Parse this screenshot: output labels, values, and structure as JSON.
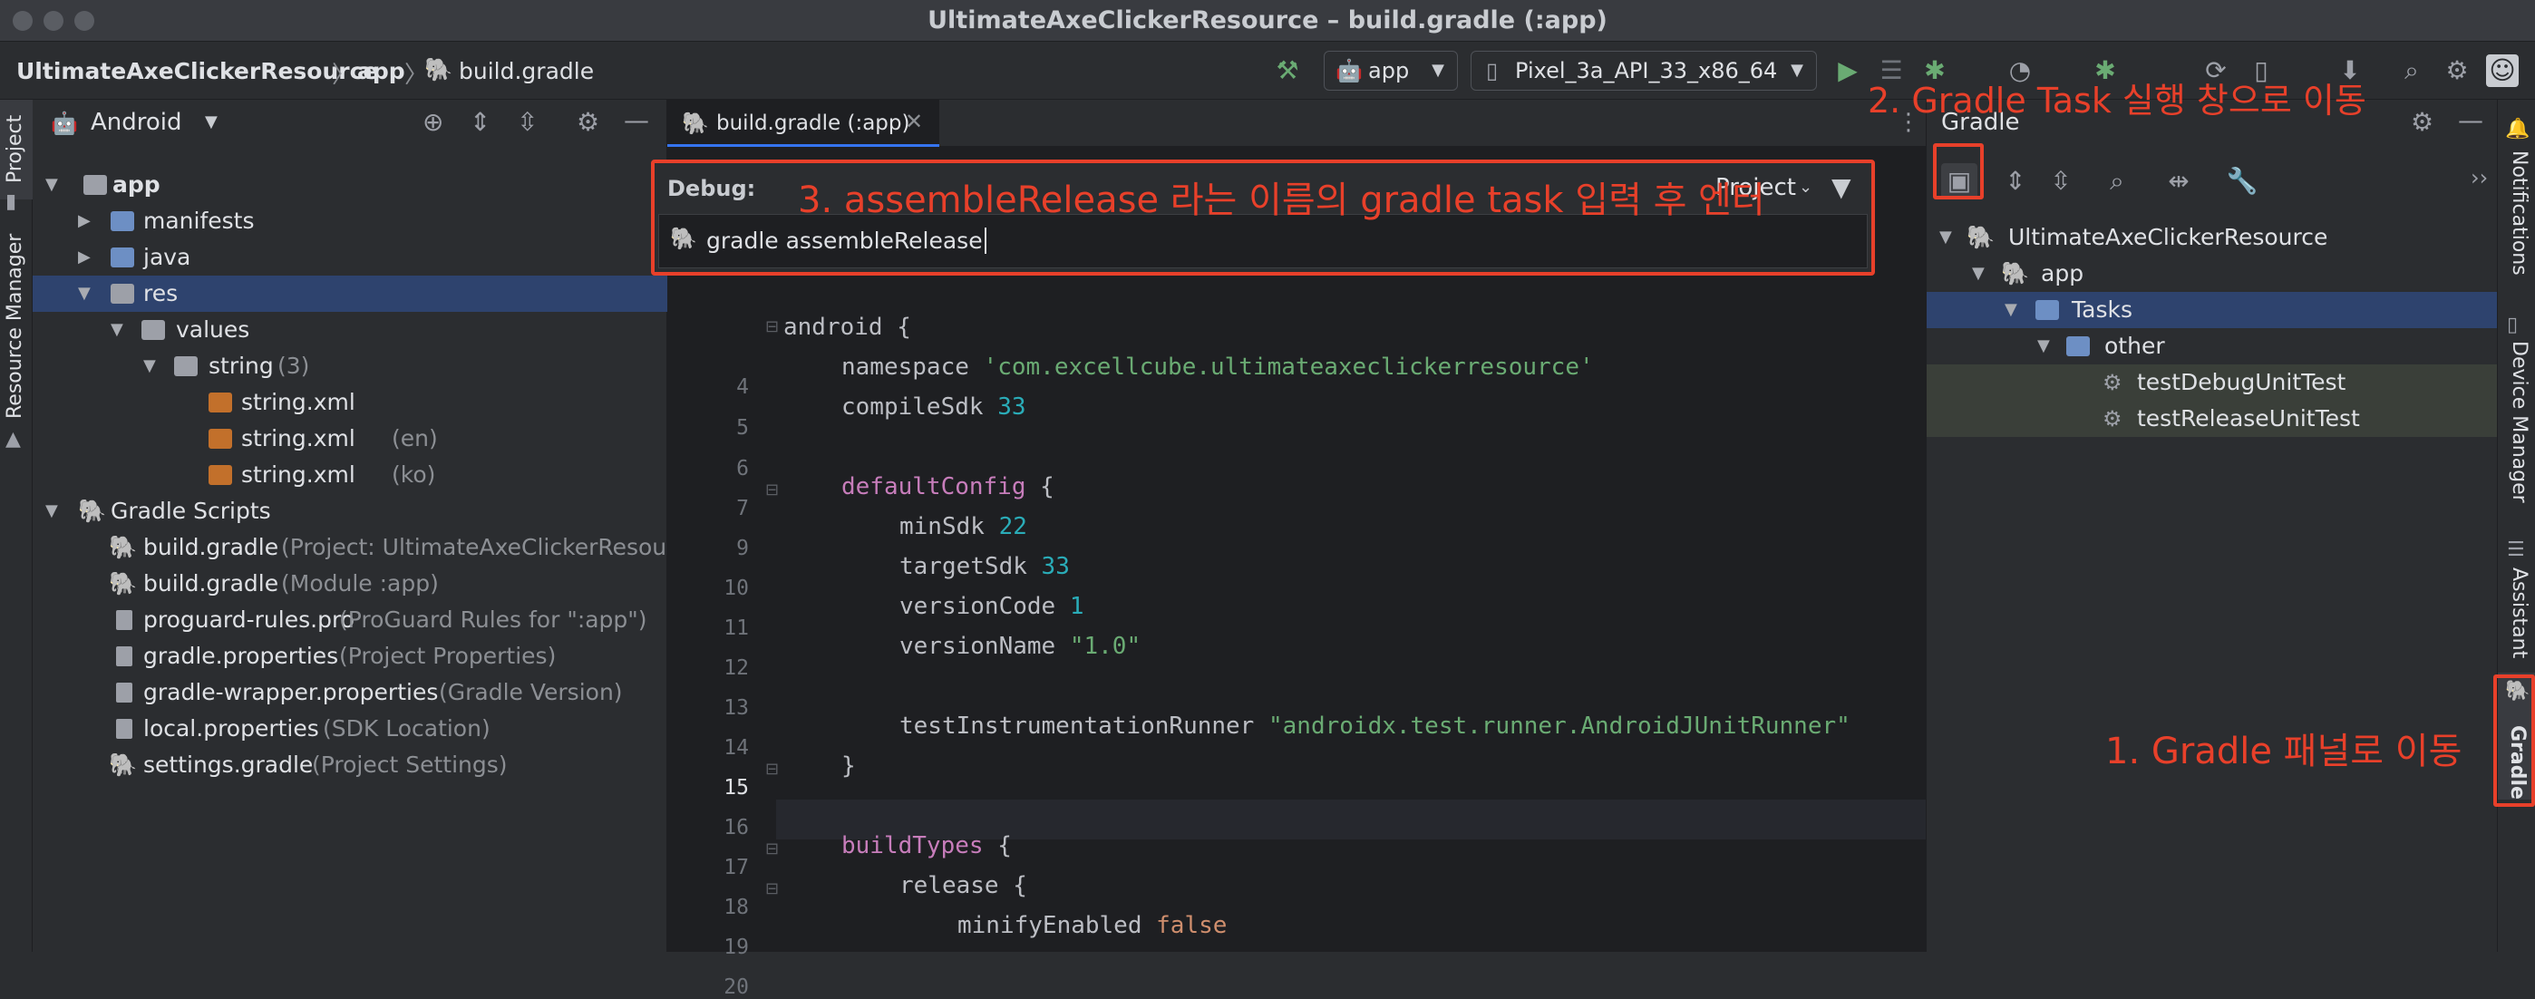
{
  "window": {
    "title": "UltimateAxeClickerResource – build.gradle (:app)"
  },
  "breadcrumb": [
    "UltimateAxeClickerResource",
    "app",
    "build.gradle"
  ],
  "toolbar": {
    "run_config": "app",
    "device": "Pixel_3a_API_33_x86_64"
  },
  "left_strip": {
    "project": "Project",
    "resource_manager": "Resource Manager"
  },
  "project_panel": {
    "view": "Android",
    "tree": [
      {
        "label": "app",
        "extra": "",
        "bold": true
      },
      {
        "label": "manifests",
        "extra": ""
      },
      {
        "label": "java",
        "extra": ""
      },
      {
        "label": "res",
        "extra": ""
      },
      {
        "label": "values",
        "extra": ""
      },
      {
        "label": "string",
        "extra": "(3)"
      },
      {
        "label": "string.xml",
        "extra": ""
      },
      {
        "label": "string.xml",
        "extra": "(en)"
      },
      {
        "label": "string.xml",
        "extra": "(ko)"
      },
      {
        "label": "Gradle Scripts",
        "extra": ""
      },
      {
        "label": "build.gradle",
        "extra": "(Project: UltimateAxeClickerResource)"
      },
      {
        "label": "build.gradle",
        "extra": "(Module :app)"
      },
      {
        "label": "proguard-rules.pro",
        "extra": "(ProGuard Rules for \":app\")"
      },
      {
        "label": "gradle.properties",
        "extra": "(Project Properties)"
      },
      {
        "label": "gradle-wrapper.properties",
        "extra": "(Gradle Version)"
      },
      {
        "label": "local.properties",
        "extra": "(SDK Location)"
      },
      {
        "label": "settings.gradle",
        "extra": "(Project Settings)"
      }
    ]
  },
  "editor": {
    "tab": "build.gradle (:app)",
    "line_numbers": [
      "4",
      "5",
      "6",
      "7",
      "9",
      "10",
      "11",
      "12",
      "13",
      "14",
      "15",
      "16",
      "17",
      "18",
      "19",
      "20"
    ],
    "code": {
      "android": "android",
      "namespace": "namespace",
      "namespace_val": "'com.excellcube.ultimateaxeclickerresource'",
      "compileSdk": "compileSdk",
      "compileSdk_val": "33",
      "defaultConfig": "defaultConfig",
      "minSdk": "minSdk",
      "minSdk_val": "22",
      "targetSdk": "targetSdk",
      "targetSdk_val": "33",
      "versionCode": "versionCode",
      "versionCode_val": "1",
      "versionName": "versionName",
      "versionName_val": "\"1.0\"",
      "runner": "testInstrumentationRunner",
      "runner_val": "\"androidx.test.runner.AndroidJUnitRunner\"",
      "buildTypes": "buildTypes",
      "release": "release",
      "minify": "minifyEnabled",
      "minify_val": "false",
      "open_brace": "{",
      "close_brace": "}"
    }
  },
  "run_popup": {
    "label": "Debug:",
    "scope": "Project",
    "input_value": "gradle assembleRelease"
  },
  "gradle_panel": {
    "title": "Gradle",
    "tree": [
      {
        "label": "UltimateAxeClickerResource"
      },
      {
        "label": "app"
      },
      {
        "label": "Tasks"
      },
      {
        "label": "other"
      },
      {
        "label": "testDebugUnitTest"
      },
      {
        "label": "testReleaseUnitTest"
      }
    ]
  },
  "right_strip": {
    "notifications": "Notifications",
    "device_manager": "Device Manager",
    "assistant": "Assistant",
    "gradle": "Gradle"
  },
  "annotations": {
    "step1": "1. Gradle 패널로 이동",
    "step2": "2. Gradle Task 실행 창으로 이동",
    "step3": "3. assembleRelease 라는 이름의 gradle task 입력 후 엔터"
  },
  "colors": {
    "annotation": "#e8402a",
    "selection": "#2e436e",
    "accent": "#3574f0"
  }
}
